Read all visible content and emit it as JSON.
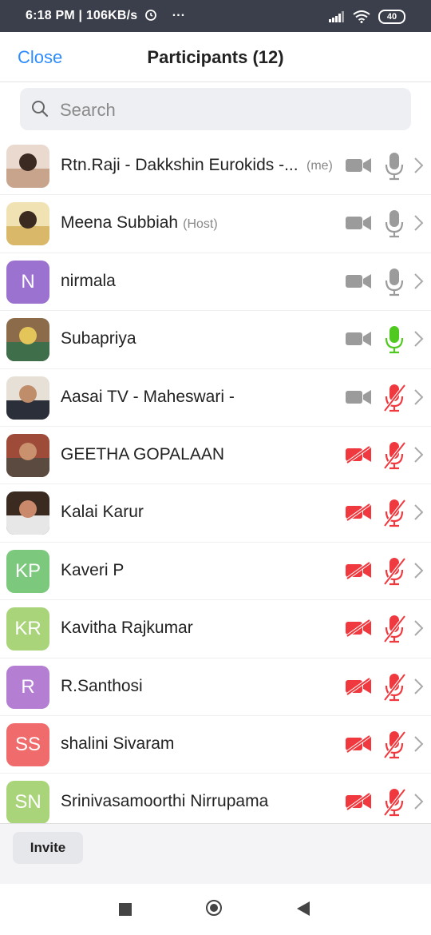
{
  "status_bar": {
    "time_info": "6:18 PM | 106KB/s",
    "more": "···",
    "battery": "40"
  },
  "header": {
    "close_label": "Close",
    "title": "Participants (12)"
  },
  "search": {
    "placeholder": "Search"
  },
  "participants": [
    {
      "name": "Rtn.Raji - Dakkshin Eurokids -...",
      "tag": "",
      "me": "(me)",
      "avatar_type": "photo",
      "video": "on",
      "mic": "on-idle"
    },
    {
      "name": "Meena Subbiah",
      "tag": "(Host)",
      "me": "",
      "avatar_type": "photo",
      "video": "on",
      "mic": "on-idle"
    },
    {
      "name": "nirmala",
      "tag": "",
      "me": "",
      "avatar_type": "initials",
      "initials": "N",
      "avatar_color": "#9b72cf",
      "video": "on",
      "mic": "on-idle"
    },
    {
      "name": "Subapriya",
      "tag": "",
      "me": "",
      "avatar_type": "photo",
      "video": "on",
      "mic": "speaking"
    },
    {
      "name": "Aasai TV - Maheswari -",
      "tag": "",
      "me": "",
      "avatar_type": "photo",
      "video": "on",
      "mic": "muted"
    },
    {
      "name": "GEETHA GOPALAAN",
      "tag": "",
      "me": "",
      "avatar_type": "photo",
      "video": "off",
      "mic": "muted"
    },
    {
      "name": "Kalai Karur",
      "tag": "",
      "me": "",
      "avatar_type": "photo",
      "video": "off",
      "mic": "muted"
    },
    {
      "name": "Kaveri P",
      "tag": "",
      "me": "",
      "avatar_type": "initials",
      "initials": "KP",
      "avatar_color": "#7cc97e",
      "video": "off",
      "mic": "muted"
    },
    {
      "name": "Kavitha Rajkumar",
      "tag": "",
      "me": "",
      "avatar_type": "initials",
      "initials": "KR",
      "avatar_color": "#a9d47a",
      "video": "off",
      "mic": "muted"
    },
    {
      "name": "R.Santhosi",
      "tag": "",
      "me": "",
      "avatar_type": "initials",
      "initials": "R",
      "avatar_color": "#b47ed3",
      "video": "off",
      "mic": "muted"
    },
    {
      "name": "shalini Sivaram",
      "tag": "",
      "me": "",
      "avatar_type": "initials",
      "initials": "SS",
      "avatar_color": "#f06b6b",
      "video": "off",
      "mic": "muted"
    },
    {
      "name": "Srinivasamoorthi Nirrupama",
      "tag": "",
      "me": "",
      "avatar_type": "initials",
      "initials": "SN",
      "avatar_color": "#a9d47a",
      "video": "off",
      "mic": "muted"
    }
  ],
  "footer": {
    "invite_label": "Invite"
  },
  "colors": {
    "accent": "#2d8cff",
    "muted_red": "#f0393f",
    "speaking_green": "#4fc920",
    "icon_gray": "#9b9b9b"
  },
  "icons": {
    "video_on": "video-camera-icon",
    "video_off": "video-camera-off-icon",
    "mic_on": "microphone-icon",
    "mic_off": "microphone-off-icon",
    "chevron": "chevron-right-icon",
    "search": "search-icon"
  }
}
